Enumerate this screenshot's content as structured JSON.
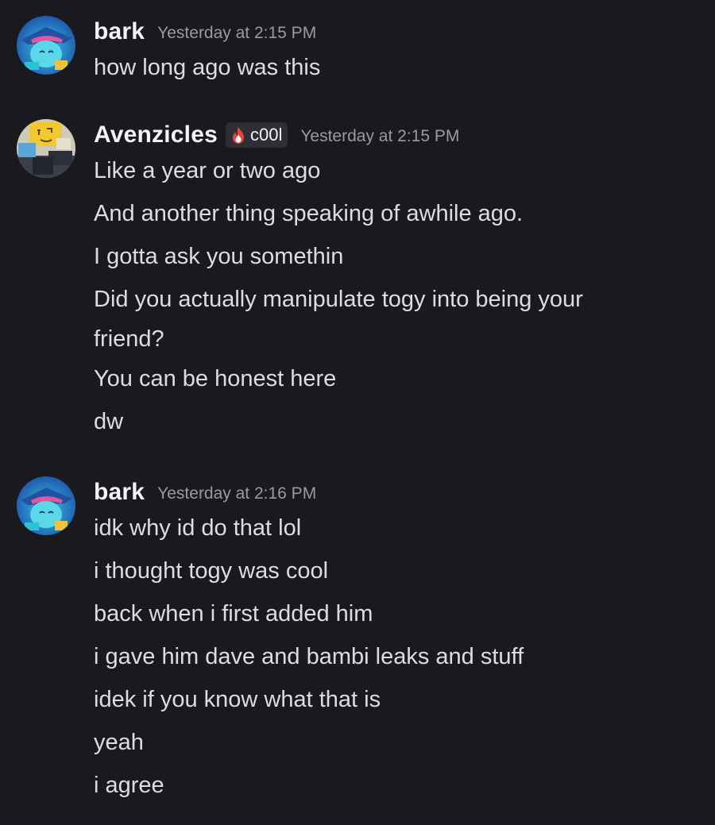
{
  "colors": {
    "background": "#1a1a1e",
    "username": "#f2f3f5",
    "timestamp": "#949ba4",
    "message_text": "#dbdee1",
    "tag_background": "#2e2f35"
  },
  "messages": [
    {
      "author": "bark",
      "avatar_icon": "blue-character-avatar-icon",
      "timestamp": "Yesterday at 2:15 PM",
      "lines": [
        "how long ago was this"
      ]
    },
    {
      "author": "Avenzicles",
      "avatar_icon": "yellow-block-character-avatar-icon",
      "tag": {
        "icon": "flame-icon",
        "label": "c00l"
      },
      "timestamp": "Yesterday at 2:15 PM",
      "lines": [
        "Like a year or two ago",
        "And another thing speaking of awhile ago.",
        "I gotta ask you somethin",
        "Did you actually manipulate togy into being your friend?",
        "You can be honest here",
        "dw"
      ]
    },
    {
      "author": "bark",
      "avatar_icon": "blue-character-avatar-icon",
      "timestamp": "Yesterday at 2:16 PM",
      "lines": [
        "idk why id do that lol",
        "i thought togy was cool",
        "back when i first added him",
        "i gave him dave and bambi leaks and stuff",
        "idek if you know what that is",
        "yeah",
        "i agree"
      ]
    }
  ]
}
